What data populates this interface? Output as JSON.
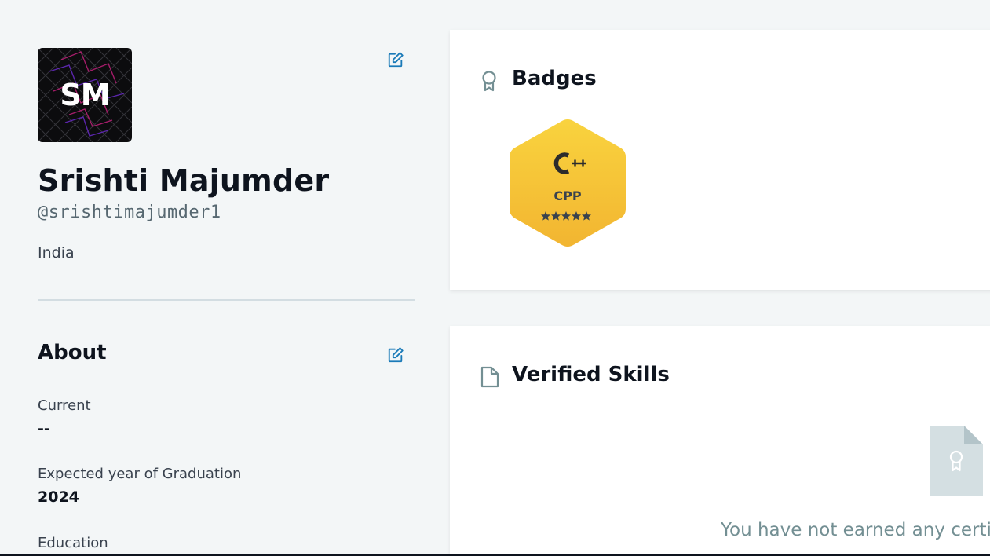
{
  "profile": {
    "avatar_initials": "SM",
    "name": "Srishti Majumder",
    "username": "@srishtimajumder1",
    "country": "India"
  },
  "about": {
    "title": "About",
    "fields": [
      {
        "label": "Current",
        "value": "--"
      },
      {
        "label": "Expected year of Graduation",
        "value": "2024"
      },
      {
        "label": "Education",
        "value": ""
      }
    ]
  },
  "badges": {
    "title": "Badges",
    "items": [
      {
        "name": "CPP",
        "icon": "cplusplus-icon",
        "stars": 5,
        "max_stars": 5
      }
    ]
  },
  "verified_skills": {
    "title": "Verified Skills",
    "empty_message": "You have not earned any certif"
  },
  "colors": {
    "accent_blue": "#1a7ab8",
    "badge_gold": "#f5c22e",
    "muted_icon": "#738f93",
    "page_bg": "#f3f6f7"
  }
}
